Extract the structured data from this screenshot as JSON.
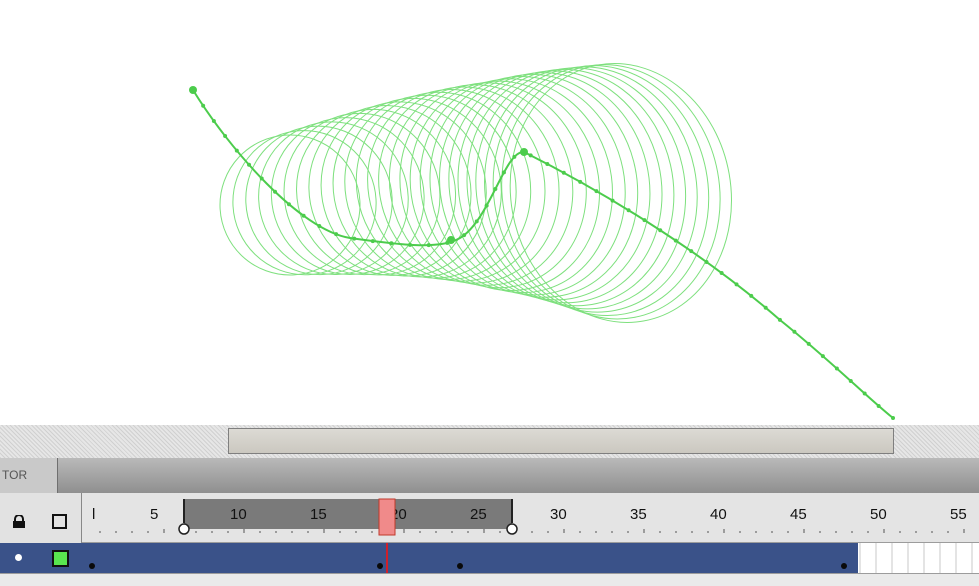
{
  "panel": {
    "tab_label": "TOR"
  },
  "timeline": {
    "frame_numbers": [
      "l",
      "5",
      "10",
      "15",
      "20",
      "25",
      "30",
      "35",
      "40",
      "45",
      "50",
      "55"
    ],
    "current_frame": 19,
    "onion_range": [
      7,
      27
    ],
    "keyframes": [
      1,
      19,
      24,
      48
    ],
    "span_end_frame": 48
  },
  "colors": {
    "path": "#5bd65b",
    "layer_span": "#3a5289",
    "playhead": "#f08080",
    "layer_swatch": "#59e64f"
  }
}
